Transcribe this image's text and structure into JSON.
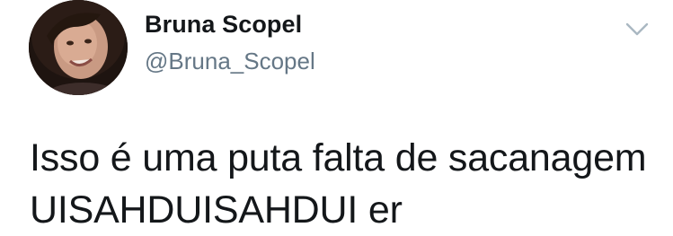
{
  "user": {
    "display_name": "Bruna Scopel",
    "handle": "@Bruna_Scopel",
    "avatar_icon": "profile-photo"
  },
  "tweet": {
    "lines": [
      "Isso é uma puta falta de sacanagem",
      "UISAHDUISAHDUI er"
    ]
  },
  "menu": {
    "icon": "chevron-down-icon",
    "color": "#aab8c2"
  }
}
